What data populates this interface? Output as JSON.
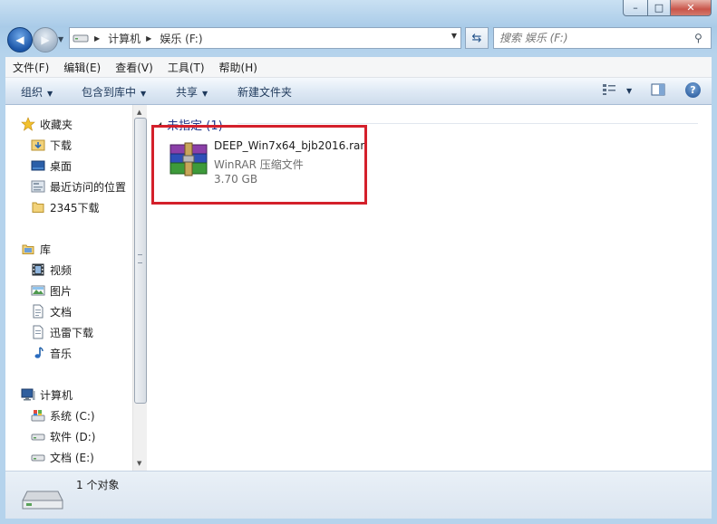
{
  "window": {
    "controls": {
      "minimize": "–",
      "maximize": "□",
      "close": "✕"
    }
  },
  "nav": {
    "address_segments": [
      "计算机",
      "娱乐 (F:)"
    ],
    "search_placeholder": "搜索 娱乐 (F:)"
  },
  "menu": [
    "文件(F)",
    "编辑(E)",
    "查看(V)",
    "工具(T)",
    "帮助(H)"
  ],
  "toolbar": {
    "organize": "组织",
    "include_in_library": "包含到库中",
    "share": "共享",
    "new_folder": "新建文件夹"
  },
  "sidebar": {
    "favorites": {
      "label": "收藏夹",
      "items": [
        "下载",
        "桌面",
        "最近访问的位置",
        "2345下载"
      ]
    },
    "libraries": {
      "label": "库",
      "items": [
        "视频",
        "图片",
        "文档",
        "迅雷下载",
        "音乐"
      ]
    },
    "computer": {
      "label": "计算机",
      "items": [
        "系统 (C:)",
        "软件 (D:)",
        "文档 (E:)"
      ]
    }
  },
  "content": {
    "group_label": "未指定 (1)",
    "file": {
      "name": "DEEP_Win7x64_bjb2016.rar",
      "type": "WinRAR 压缩文件",
      "size": "3.70 GB"
    }
  },
  "status": {
    "count": "1 个对象"
  },
  "colors": {
    "highlight_border": "#d4202b",
    "group_text": "#1e3287"
  }
}
